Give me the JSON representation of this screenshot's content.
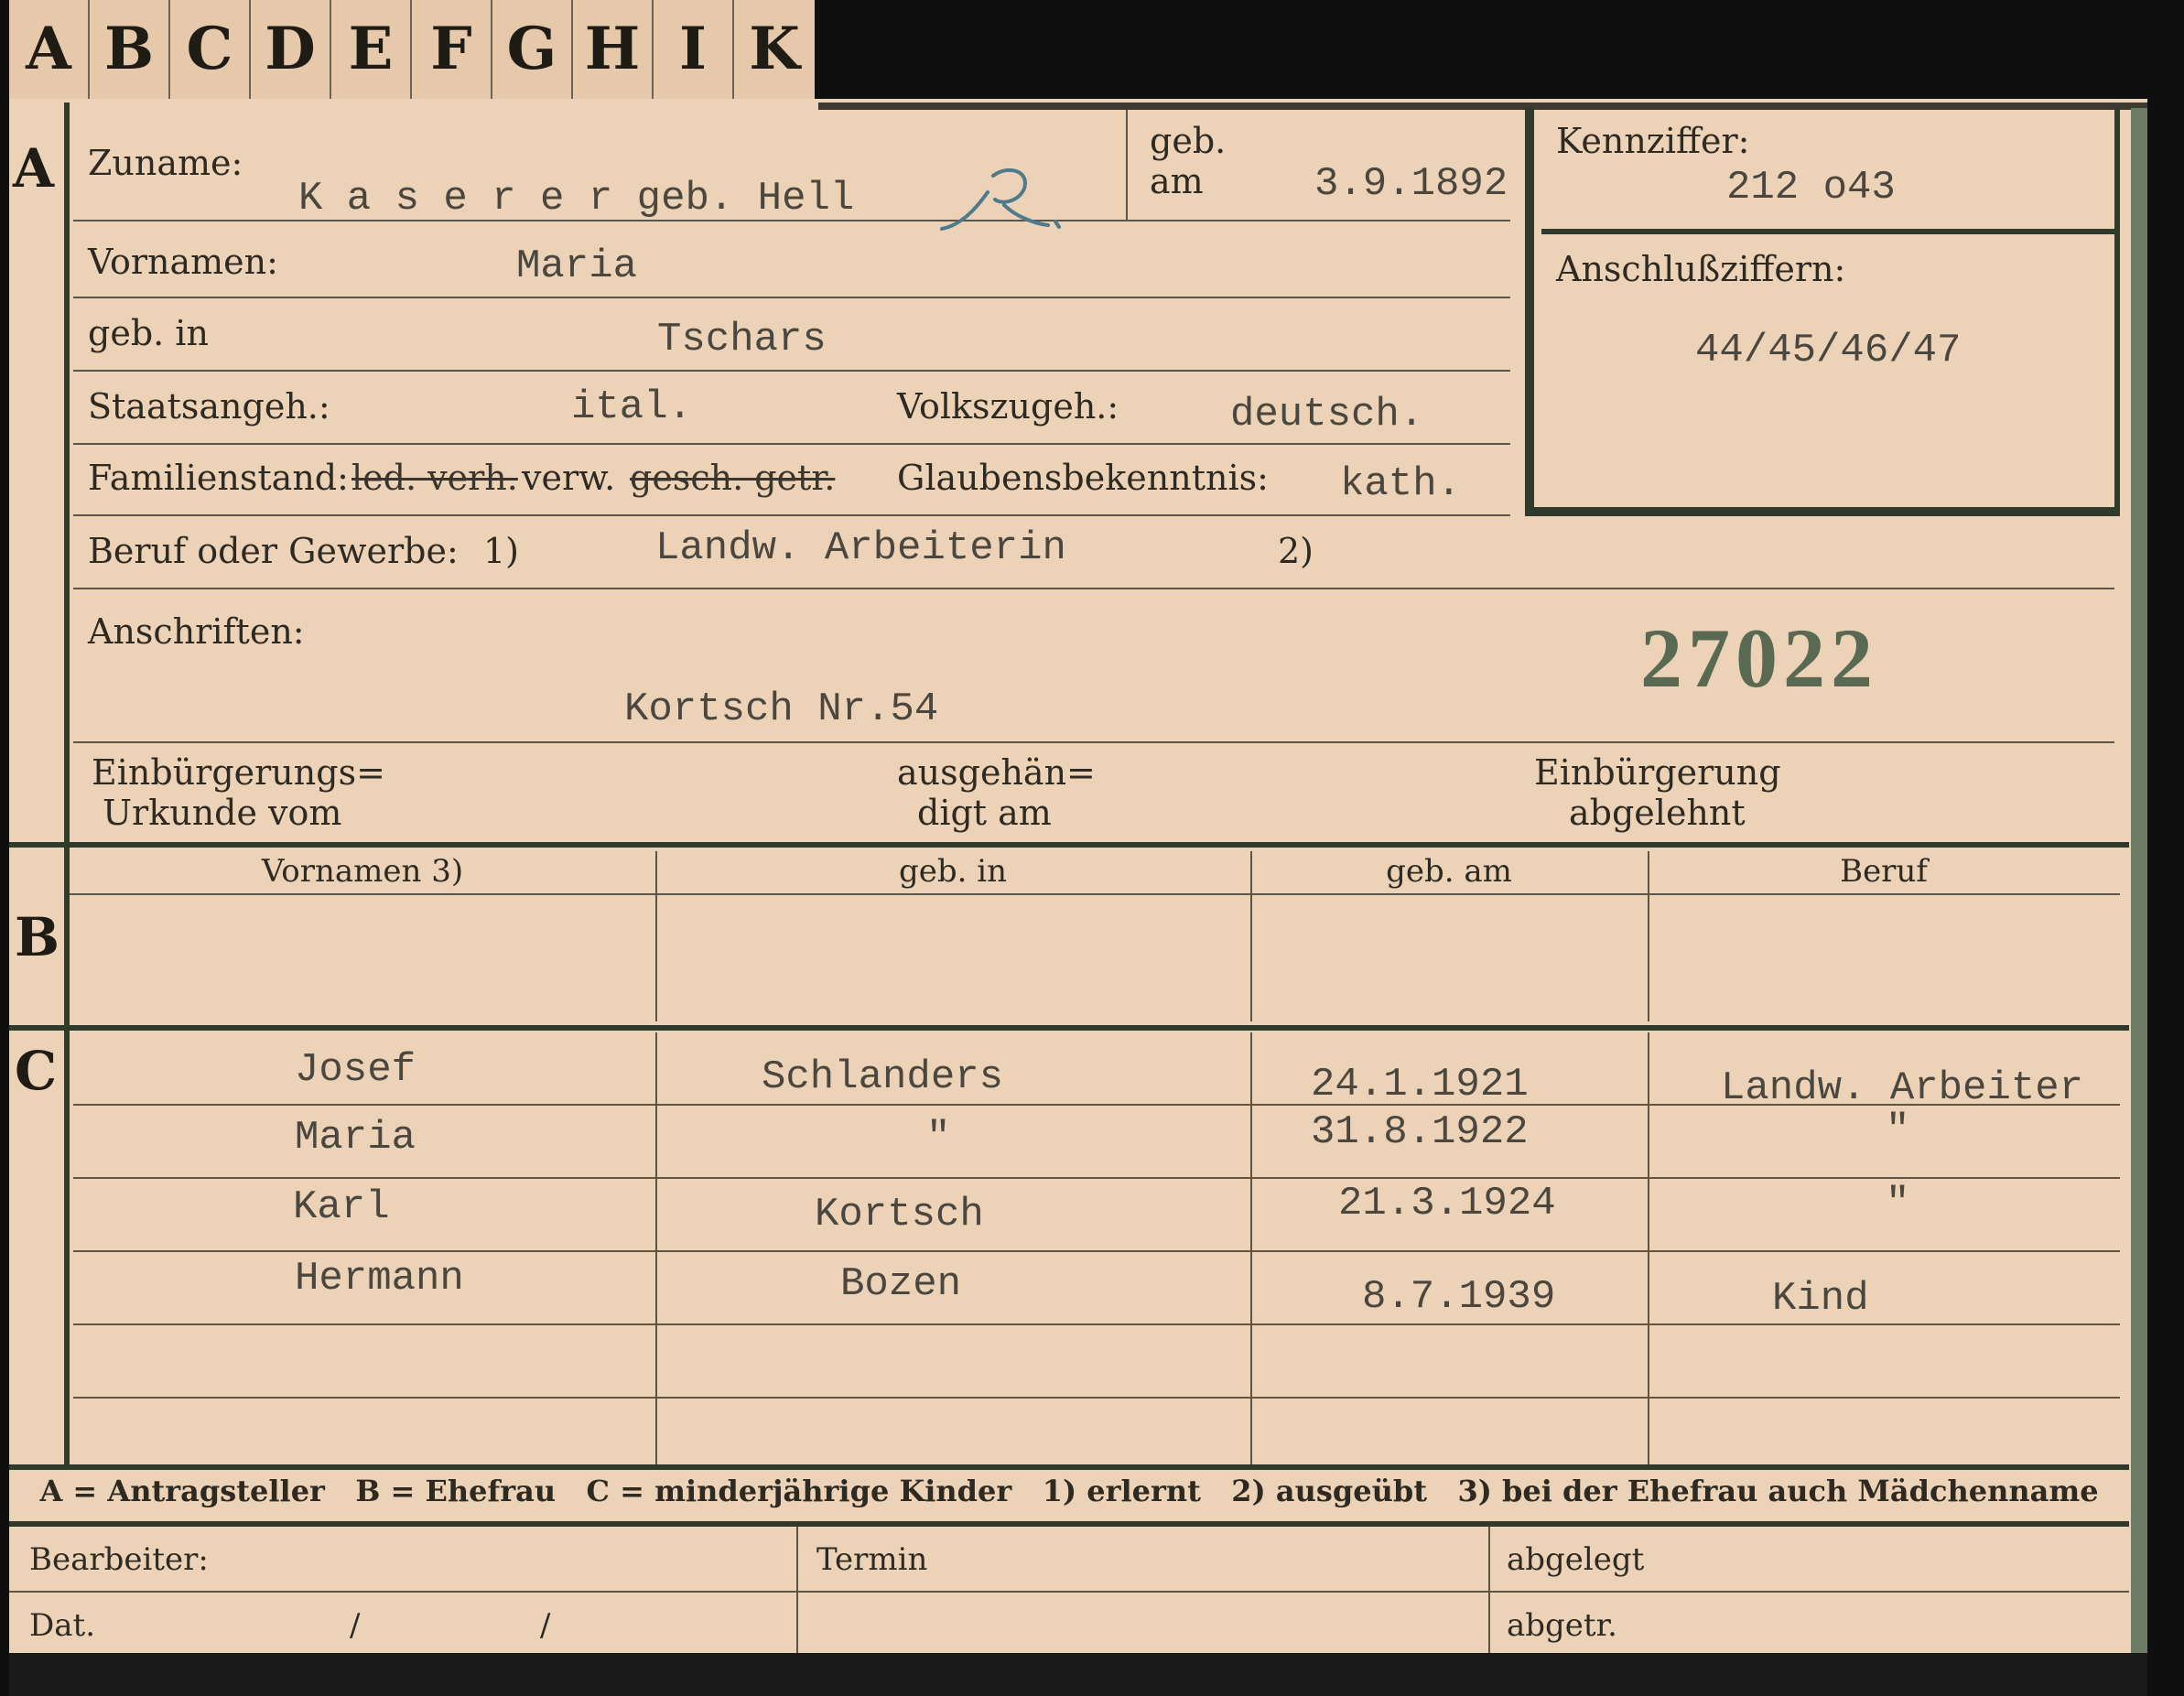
{
  "tabs": [
    "A",
    "B",
    "C",
    "D",
    "E",
    "F",
    "G",
    "H",
    "I",
    "K"
  ],
  "sections": {
    "a": "A",
    "b": "B",
    "c": "C"
  },
  "card": {
    "zuname": {
      "label": "Zuname:",
      "value": "K a s e r e r geb. Hell"
    },
    "geb_am": {
      "label_top": "geb.",
      "label_bottom": "am",
      "value": "3.9.1892"
    },
    "kennziffer": {
      "label": "Kennziffer:",
      "value": "212 o43"
    },
    "anschlussziffern": {
      "label": "Anschlußziffern:",
      "value": "44/45/46/47"
    },
    "vornamen": {
      "label": "Vornamen:",
      "value": "Maria"
    },
    "geb_in": {
      "label": "geb. in",
      "value": "Tschars"
    },
    "staatsangeh": {
      "label": "Staatsangeh.:",
      "value": "ital."
    },
    "volkszugeh": {
      "label": "Volkszugeh.:",
      "value": "deutsch."
    },
    "familienstand": {
      "label": "Familienstand:",
      "struck1": "led. verh.",
      "kept": "verw.",
      "struck2": "gesch. getr."
    },
    "glaubensbekenntnis": {
      "label": "Glaubensbekenntnis:",
      "value": "kath."
    },
    "beruf": {
      "label": "Beruf oder Gewerbe:",
      "mark1": "1)",
      "value": "Landw. Arbeiterin",
      "mark2": "2)"
    },
    "anschriften": {
      "label": "Anschriften:",
      "value": "Kortsch Nr.54"
    },
    "stamp_number": "27022",
    "einbuergerung": {
      "urkunde_line1": "Einbürgerungs=",
      "urkunde_line2": "Urkunde vom",
      "ausgehaendigt_line1": "ausgehän=",
      "ausgehaendigt_line2": "digt am",
      "abgelehnt_line1": "Einbürgerung",
      "abgelehnt_line2": "abgelehnt"
    }
  },
  "table": {
    "headers": [
      "Vornamen 3)",
      "geb. in",
      "geb. am",
      "Beruf"
    ],
    "children": [
      {
        "vorname": "Josef",
        "geb_in": "Schlanders",
        "geb_am": "24.1.1921",
        "beruf": "Landw. Arbeiter"
      },
      {
        "vorname": "Maria",
        "geb_in": "\"",
        "geb_am": "31.8.1922",
        "beruf": "\""
      },
      {
        "vorname": "Karl",
        "geb_in": "Kortsch",
        "geb_am": "21.3.1924",
        "beruf": "\""
      },
      {
        "vorname": "Hermann",
        "geb_in": "Bozen",
        "geb_am": "8.7.1939",
        "beruf": "Kind"
      }
    ]
  },
  "legend": "A = Antragsteller   B = Ehefrau   C = minderjährige Kinder   1) erlernt   2) ausgeübt   3) bei der Ehefrau auch Mädchenname",
  "footer": {
    "bearbeiter": "Bearbeiter:",
    "dat": "Dat.",
    "slash1": "/",
    "slash2": "/",
    "termin": "Termin",
    "abgelegt": "abgelegt",
    "abgetr": "abgetr."
  },
  "colors": {
    "paper": "#ecd3b7",
    "ink": "#4b473f",
    "stamp": "#5a6a52",
    "rule": "#2f3a2a"
  }
}
